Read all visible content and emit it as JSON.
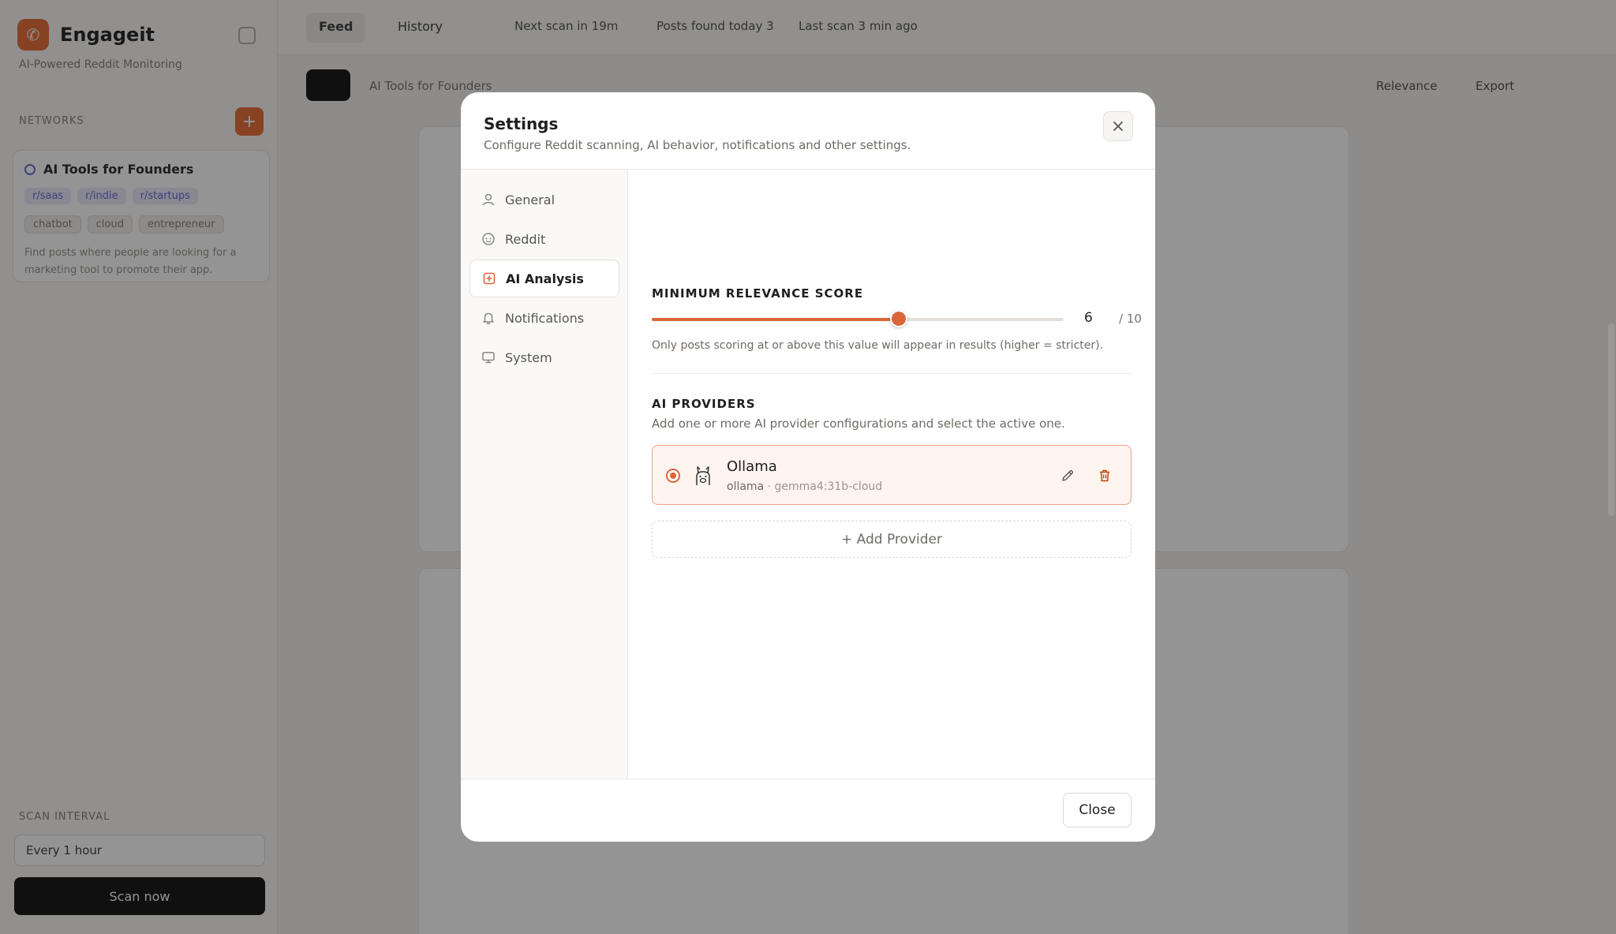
{
  "background": {
    "brand": {
      "name": "Engageit",
      "tagline": "AI-Powered Reddit Monitoring"
    },
    "networks_label": "NETWORKS",
    "network": {
      "title": "AI Tools for Founders",
      "subreddits": [
        "r/saas",
        "r/indie",
        "r/startups"
      ],
      "keywords": [
        "chatbot",
        "cloud",
        "entrepreneur"
      ],
      "description": "Find posts where people are looking for a marketing tool to promote their app."
    },
    "scan_interval_label": "SCAN INTERVAL",
    "scan_interval_value": "Every 1 hour",
    "scan_now": "Scan now",
    "tabs": [
      "Feed",
      "History"
    ],
    "next_scan": "Next scan in 19m",
    "posts_found": "Posts found today 3",
    "last_scan": "Last scan 3 min ago",
    "filter_label": "AI Tools for Founders",
    "sort_label": "Relevance",
    "export_label": "Export"
  },
  "modal": {
    "title": "Settings",
    "subtitle": "Configure Reddit scanning, AI behavior, notifications and other settings.",
    "nav": [
      {
        "label": "General",
        "icon": "user-icon"
      },
      {
        "label": "Reddit",
        "icon": "reddit-icon"
      },
      {
        "label": "AI Analysis",
        "icon": "ai-icon"
      },
      {
        "label": "Notifications",
        "icon": "bell-icon"
      },
      {
        "label": "System",
        "icon": "monitor-icon"
      }
    ],
    "active_nav": "AI Analysis",
    "relevance": {
      "heading": "MINIMUM RELEVANCE SCORE",
      "value": 6,
      "value_label": "6",
      "max": 10,
      "max_label": "/ 10",
      "help": "Only posts scoring at or above this value will appear in results (higher = stricter)."
    },
    "providers": {
      "heading": "AI PROVIDERS",
      "help": "Add one or more AI provider configurations and select the active one.",
      "items": [
        {
          "name": "Ollama",
          "type": "ollama",
          "separator": " · ",
          "model": "gemma4:31b-cloud",
          "selected": true
        }
      ],
      "add_label": "+ Add Provider"
    },
    "close_label": "Close"
  },
  "colors": {
    "accent": "#d9663a",
    "accent_soft": "#fdf4ef",
    "overlay": "rgba(0,0,0,0.42)"
  }
}
